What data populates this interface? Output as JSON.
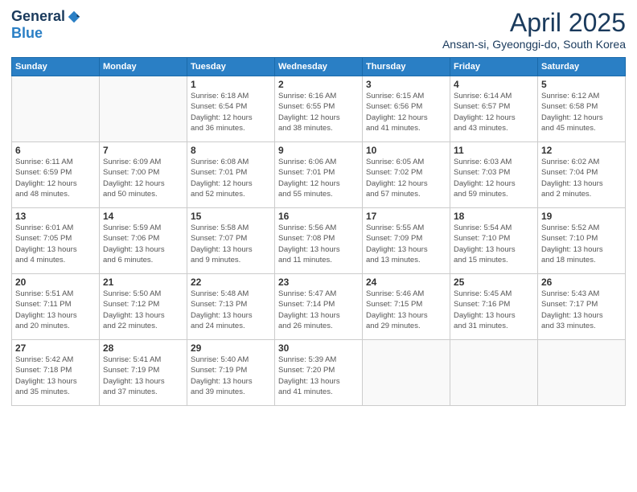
{
  "header": {
    "logo_general": "General",
    "logo_blue": "Blue",
    "main_title": "April 2025",
    "subtitle": "Ansan-si, Gyeonggi-do, South Korea"
  },
  "columns": [
    "Sunday",
    "Monday",
    "Tuesday",
    "Wednesday",
    "Thursday",
    "Friday",
    "Saturday"
  ],
  "weeks": [
    [
      {
        "day": "",
        "info": ""
      },
      {
        "day": "",
        "info": ""
      },
      {
        "day": "1",
        "info": "Sunrise: 6:18 AM\nSunset: 6:54 PM\nDaylight: 12 hours\nand 36 minutes."
      },
      {
        "day": "2",
        "info": "Sunrise: 6:16 AM\nSunset: 6:55 PM\nDaylight: 12 hours\nand 38 minutes."
      },
      {
        "day": "3",
        "info": "Sunrise: 6:15 AM\nSunset: 6:56 PM\nDaylight: 12 hours\nand 41 minutes."
      },
      {
        "day": "4",
        "info": "Sunrise: 6:14 AM\nSunset: 6:57 PM\nDaylight: 12 hours\nand 43 minutes."
      },
      {
        "day": "5",
        "info": "Sunrise: 6:12 AM\nSunset: 6:58 PM\nDaylight: 12 hours\nand 45 minutes."
      }
    ],
    [
      {
        "day": "6",
        "info": "Sunrise: 6:11 AM\nSunset: 6:59 PM\nDaylight: 12 hours\nand 48 minutes."
      },
      {
        "day": "7",
        "info": "Sunrise: 6:09 AM\nSunset: 7:00 PM\nDaylight: 12 hours\nand 50 minutes."
      },
      {
        "day": "8",
        "info": "Sunrise: 6:08 AM\nSunset: 7:01 PM\nDaylight: 12 hours\nand 52 minutes."
      },
      {
        "day": "9",
        "info": "Sunrise: 6:06 AM\nSunset: 7:01 PM\nDaylight: 12 hours\nand 55 minutes."
      },
      {
        "day": "10",
        "info": "Sunrise: 6:05 AM\nSunset: 7:02 PM\nDaylight: 12 hours\nand 57 minutes."
      },
      {
        "day": "11",
        "info": "Sunrise: 6:03 AM\nSunset: 7:03 PM\nDaylight: 12 hours\nand 59 minutes."
      },
      {
        "day": "12",
        "info": "Sunrise: 6:02 AM\nSunset: 7:04 PM\nDaylight: 13 hours\nand 2 minutes."
      }
    ],
    [
      {
        "day": "13",
        "info": "Sunrise: 6:01 AM\nSunset: 7:05 PM\nDaylight: 13 hours\nand 4 minutes."
      },
      {
        "day": "14",
        "info": "Sunrise: 5:59 AM\nSunset: 7:06 PM\nDaylight: 13 hours\nand 6 minutes."
      },
      {
        "day": "15",
        "info": "Sunrise: 5:58 AM\nSunset: 7:07 PM\nDaylight: 13 hours\nand 9 minutes."
      },
      {
        "day": "16",
        "info": "Sunrise: 5:56 AM\nSunset: 7:08 PM\nDaylight: 13 hours\nand 11 minutes."
      },
      {
        "day": "17",
        "info": "Sunrise: 5:55 AM\nSunset: 7:09 PM\nDaylight: 13 hours\nand 13 minutes."
      },
      {
        "day": "18",
        "info": "Sunrise: 5:54 AM\nSunset: 7:10 PM\nDaylight: 13 hours\nand 15 minutes."
      },
      {
        "day": "19",
        "info": "Sunrise: 5:52 AM\nSunset: 7:10 PM\nDaylight: 13 hours\nand 18 minutes."
      }
    ],
    [
      {
        "day": "20",
        "info": "Sunrise: 5:51 AM\nSunset: 7:11 PM\nDaylight: 13 hours\nand 20 minutes."
      },
      {
        "day": "21",
        "info": "Sunrise: 5:50 AM\nSunset: 7:12 PM\nDaylight: 13 hours\nand 22 minutes."
      },
      {
        "day": "22",
        "info": "Sunrise: 5:48 AM\nSunset: 7:13 PM\nDaylight: 13 hours\nand 24 minutes."
      },
      {
        "day": "23",
        "info": "Sunrise: 5:47 AM\nSunset: 7:14 PM\nDaylight: 13 hours\nand 26 minutes."
      },
      {
        "day": "24",
        "info": "Sunrise: 5:46 AM\nSunset: 7:15 PM\nDaylight: 13 hours\nand 29 minutes."
      },
      {
        "day": "25",
        "info": "Sunrise: 5:45 AM\nSunset: 7:16 PM\nDaylight: 13 hours\nand 31 minutes."
      },
      {
        "day": "26",
        "info": "Sunrise: 5:43 AM\nSunset: 7:17 PM\nDaylight: 13 hours\nand 33 minutes."
      }
    ],
    [
      {
        "day": "27",
        "info": "Sunrise: 5:42 AM\nSunset: 7:18 PM\nDaylight: 13 hours\nand 35 minutes."
      },
      {
        "day": "28",
        "info": "Sunrise: 5:41 AM\nSunset: 7:19 PM\nDaylight: 13 hours\nand 37 minutes."
      },
      {
        "day": "29",
        "info": "Sunrise: 5:40 AM\nSunset: 7:19 PM\nDaylight: 13 hours\nand 39 minutes."
      },
      {
        "day": "30",
        "info": "Sunrise: 5:39 AM\nSunset: 7:20 PM\nDaylight: 13 hours\nand 41 minutes."
      },
      {
        "day": "",
        "info": ""
      },
      {
        "day": "",
        "info": ""
      },
      {
        "day": "",
        "info": ""
      }
    ]
  ]
}
